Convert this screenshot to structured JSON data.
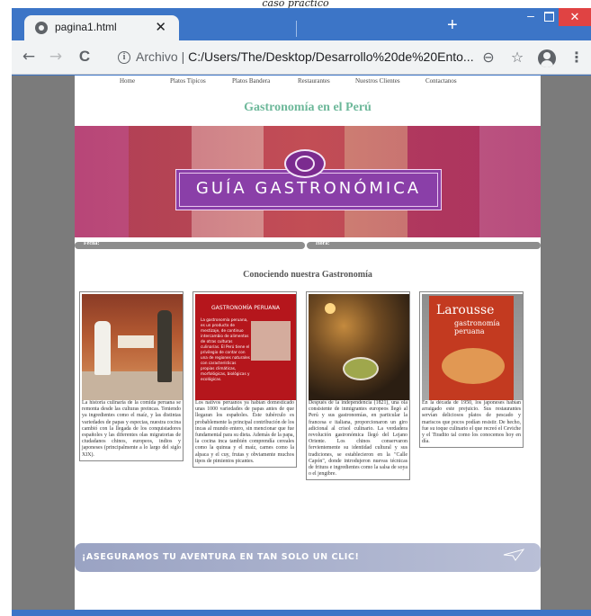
{
  "caption": "caso práctico",
  "browser": {
    "tab_title": "pagina1.html",
    "tab_close": "✕",
    "new_tab": "+",
    "window_controls": {
      "minimize": "–",
      "close": "✕"
    },
    "nav": {
      "back": "←",
      "forward": "→",
      "reload": "C"
    },
    "address": {
      "scheme_label": "Archivo",
      "separator": "|",
      "url": "C:/Users/The/Desktop/Desarrollo%20de%20Ento..."
    },
    "icons": {
      "zoom": "search-icon",
      "bookmark": "star-icon",
      "profile": "account-icon",
      "menu": "kebab-menu-icon"
    },
    "menu_glyph": "⋮",
    "star_glyph": "☆",
    "zoom_glyph": "⊖"
  },
  "page": {
    "nav": [
      "Home",
      "Platos Típicos",
      "Platos Bandera",
      "Restaurantes",
      "Nuestros Clientes",
      "Contactanos"
    ],
    "title": "Gastronomía en el Perú",
    "banner_text": "GUÍA GASTRONÓMICA",
    "fecha_label": "Fecha:",
    "hora_label": "Hora:",
    "section_title": "Conociendo nuestra Gastronomía",
    "cards": [
      {
        "text": "La historia culinaria de la comida peruana se remonta desde las culturas preincas. Teniendo ya ingredientes como el maíz, y las distintas variedades de papas y especias, nuestra cocina cambió con la llegada de los conquistadores españoles y las diferentes olas migratorias de ciudadanos chinos, europeos, indios y japoneses (principalmente a lo largo del siglo XIX)."
      },
      {
        "image_title": "GASTRONOMÍA PERUANA",
        "image_text": "La gastronomía peruana, es un producto de mestizaje, de continuo intercambio de alimentos de otras culturas culinarias. El Perú tiene el privilegio de contar con una de regiones naturales con características propias climáticas, morfológicas, biológicas y ecológicas.",
        "text": "Los nativos peruanos ya habían domesticado unas 1000 variedades de papas antes de que llegaran los españoles. Éste tubérculo es probablemente la principal contribución de los incas al mundo entero, sin mencionar que fue fundamental para su dieta. Además de la papa, la cocina inca también comprendía cereales como la quinua y el maíz, carnes como la alpaca y el cuy, frutas y obviamente muchos tipos de pimientos picantes."
      },
      {
        "text": "Después de la independencia (1821), una ola consistente de inmigrantes europeos llegó al Perú y sus gastronomías, en particular la francesa e italiana, proporcionaron un giro adicional al crisol culinario. La verdadera revolución gastronómica llegó del Lejano Oriente. Los chinos conservaron fervientemente su identidad cultural y sus tradiciones, se establecieron en la \"Calle Capón\", donde introdujeron nuevas técnicas de fritura e ingredientes como la salsa de soya o el jengibre."
      },
      {
        "image_title": "Larousse",
        "image_sub": "gastronomía peruana",
        "text": "En la década de 1950, los japoneses habían arraigado este prejuicio. Sus restaurantes servían deliciosos platos de pescado y mariscos que pocos podían resistir. De hecho, fue su toque culinario el que recreó el Ceviche y el Tiradito tal como los conocemos hoy en día."
      }
    ],
    "footer_banner": "¡ASEGURAMOS TU AVENTURA EN TAN SOLO UN CLIC!"
  }
}
